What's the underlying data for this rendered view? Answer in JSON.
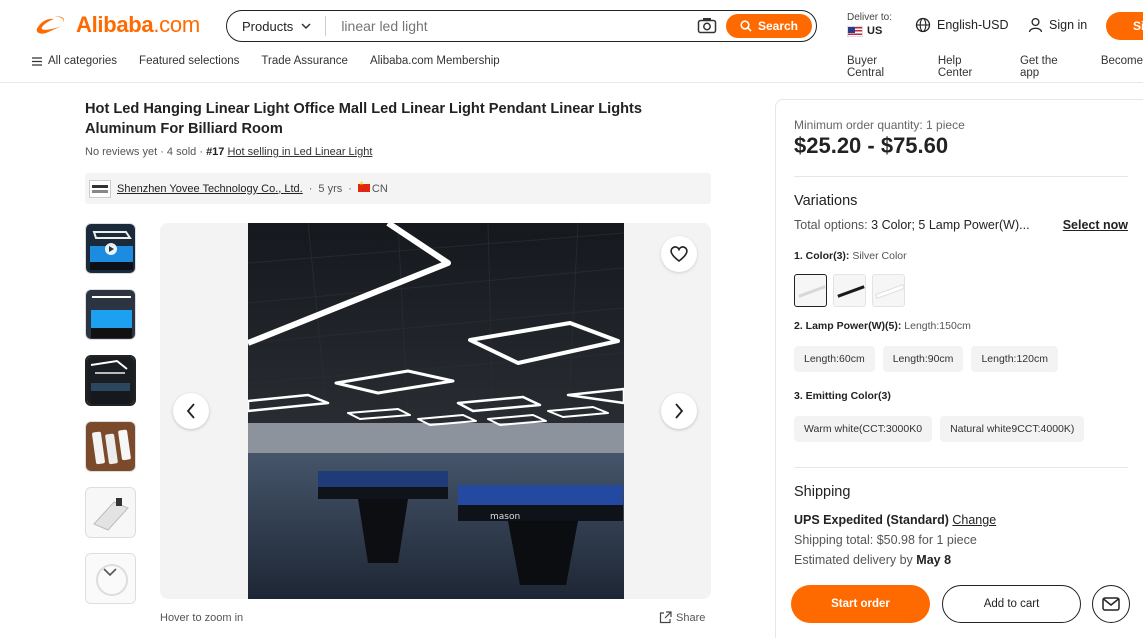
{
  "header": {
    "logo_text": "Alibaba",
    "logo_suffix": ".com",
    "search_category": "Products",
    "search_placeholder": "linear led light",
    "search_button": "Search",
    "deliver_label": "Deliver to:",
    "deliver_country": "US",
    "language": "English-USD",
    "sign_in": "Sign in",
    "sign_up": "Si"
  },
  "nav": {
    "all_categories": "All categories",
    "left": [
      "Featured selections",
      "Trade Assurance",
      "Alibaba.com Membership"
    ],
    "right": [
      "Buyer Central",
      "Help Center",
      "Get the app",
      "Become"
    ]
  },
  "product": {
    "title": "Hot Led Hanging Linear Light Office Mall Led Linear Light Pendant Linear Lights Aluminum For Billiard Room",
    "reviews": "No reviews yet",
    "sold": "4 sold",
    "rank": "#17",
    "rank_link": "Hot selling in Led Linear Light",
    "supplier_name": "Shenzhen Yovee Technology Co., Ltd.",
    "supplier_years": "5 yrs",
    "supplier_country": "CN",
    "hover_zoom": "Hover to zoom in",
    "share": "Share"
  },
  "panel": {
    "moq": "Minimum order quantity: 1 piece",
    "price": "$25.20 - $75.60",
    "variations_title": "Variations",
    "total_options_label": "Total options:",
    "total_options_value": "3 Color; 5 Lamp Power(W)...",
    "select_now": "Select now",
    "color_label": "1. Color(3):",
    "color_selected": "Silver Color",
    "power_label": "2. Lamp Power(W)(5):",
    "power_selected": "Length:150cm",
    "power_options": [
      "Length:60cm",
      "Length:90cm",
      "Length:120cm"
    ],
    "emitting_label": "3. Emitting Color(3)",
    "emitting_options": [
      "Warm white(CCT:3000K0",
      "Natural white9CCT:4000K)"
    ],
    "shipping_title": "Shipping",
    "shipping_method": "UPS Expedited (Standard)",
    "shipping_change": "Change",
    "shipping_total_label": "Shipping total:",
    "shipping_total_value": "$50.98 for 1 piece",
    "delivery_label": "Estimated delivery by",
    "delivery_date": "May 8",
    "start_order": "Start order",
    "add_to_cart": "Add to cart"
  },
  "colors": {
    "accent": "#ff6a00"
  }
}
